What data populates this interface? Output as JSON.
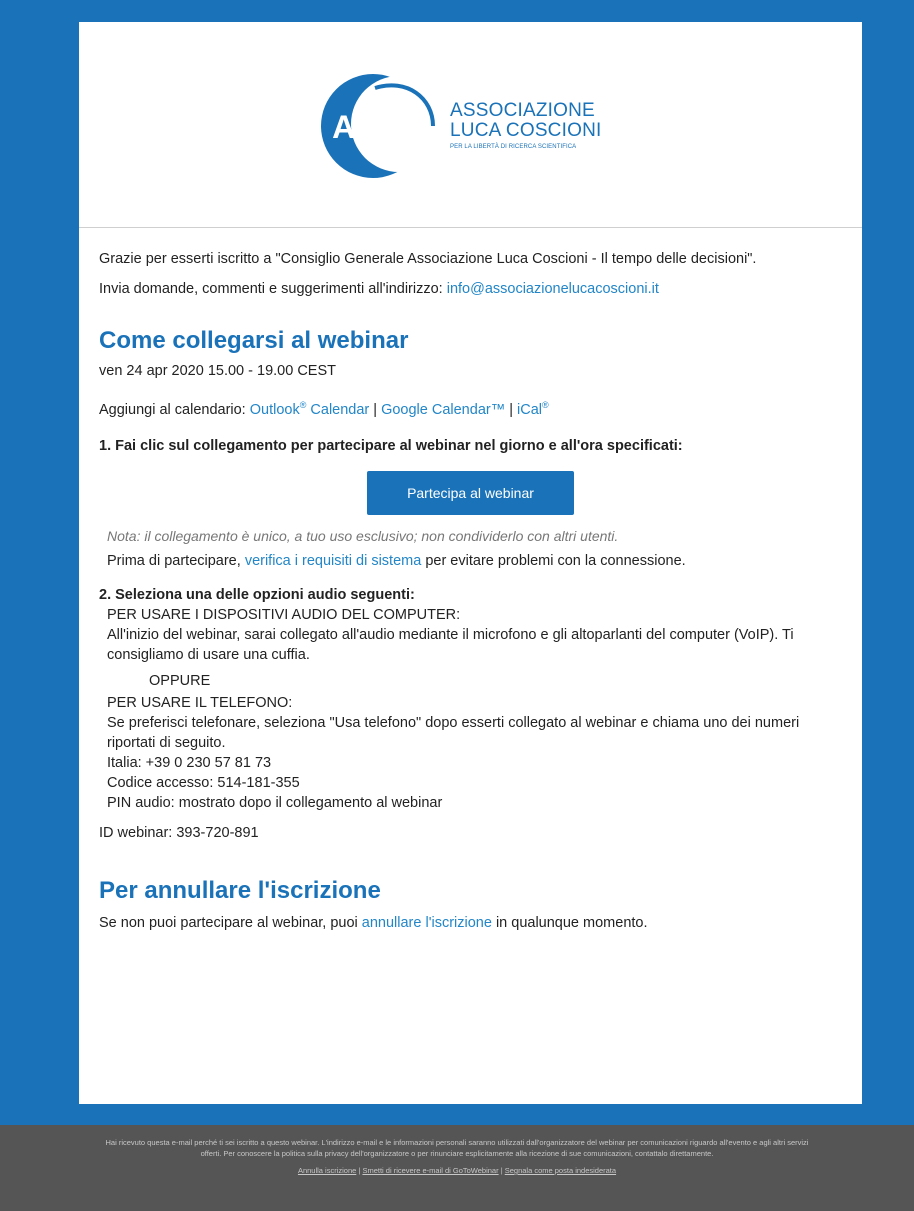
{
  "logo": {
    "line1": "ASSOCIAZIONE",
    "line2": "LUCA COSCIONI",
    "line3": "PER LA LIBERTÀ DI RICERCA SCIENTIFICA",
    "mark": "ALC"
  },
  "intro": {
    "thanks": "Grazie per esserti iscritto a \"Consiglio Generale Associazione Luca Coscioni - Il tempo delle decisioni\".",
    "contact_prefix": "Invia domande, commenti e suggerimenti all'indirizzo: ",
    "contact_email": "info@associazionelucacoscioni.it"
  },
  "connect": {
    "heading": "Come collegarsi al webinar",
    "datetime": "ven 24 apr 2020 15.00 - 19.00 CEST",
    "calendar_prefix": "Aggiungi al calendario: ",
    "outlook": "Outlook",
    "outlook_suffix": " Calendar",
    "reg": "®",
    "sep": " | ",
    "google": "Google Calendar™",
    "ical": "iCal",
    "step1": "1. Fai clic sul collegamento per partecipare al webinar nel giorno e all'ora specificati:",
    "join_button": "Partecipa al webinar",
    "note": "Nota: il collegamento è unico, a tuo uso esclusivo; non condividerlo con altri utenti.",
    "req_prefix": "Prima di partecipare, ",
    "req_link": "verifica i requisiti di sistema",
    "req_suffix": " per evitare problemi con la connessione.",
    "step2": "2. Seleziona una delle opzioni audio seguenti:",
    "computer_title": "PER USARE I DISPOSITIVI AUDIO DEL COMPUTER:",
    "computer_desc": "All'inizio del webinar, sarai collegato all'audio mediante il microfono e gli altoparlanti del computer (VoIP). Ti consigliamo di usare una cuffia.",
    "oppure": "OPPURE",
    "phone_title": "PER USARE IL TELEFONO:",
    "phone_desc": "Se preferisci telefonare, seleziona \"Usa telefono\" dopo esserti collegato al webinar e chiama uno dei numeri riportati di seguito.",
    "phone_italy": "Italia: +39 0 230 57 81 73",
    "access_code": "Codice accesso: 514-181-355",
    "pin": "PIN audio: mostrato dopo il collegamento al webinar",
    "webinar_id": "ID webinar: 393-720-891"
  },
  "cancel": {
    "heading": "Per annullare l'iscrizione",
    "prefix": "Se non puoi partecipare al webinar, puoi ",
    "link": "annullare l'iscrizione",
    "suffix": " in qualunque momento."
  },
  "footer": {
    "text": "Hai ricevuto questa e-mail perché ti sei iscritto a questo webinar. L'indirizzo e-mail e le informazioni personali saranno utilizzati dall'organizzatore del webinar per comunicazioni riguardo all'evento e agli altri servizi offerti. Per conoscere la politica sulla privacy dell'organizzatore o per rinunciare esplicitamente alla ricezione di sue comunicazioni, contattalo direttamente.",
    "link1": "Annulla iscrizione",
    "link2": "Smetti di ricevere e-mail di GoToWebinar",
    "link3": "Segnala come posta indesiderata",
    "sep": " | "
  },
  "colors": {
    "brand_blue": "#1a72b8",
    "link_blue": "#2286c8",
    "footer_bg": "#555555"
  }
}
